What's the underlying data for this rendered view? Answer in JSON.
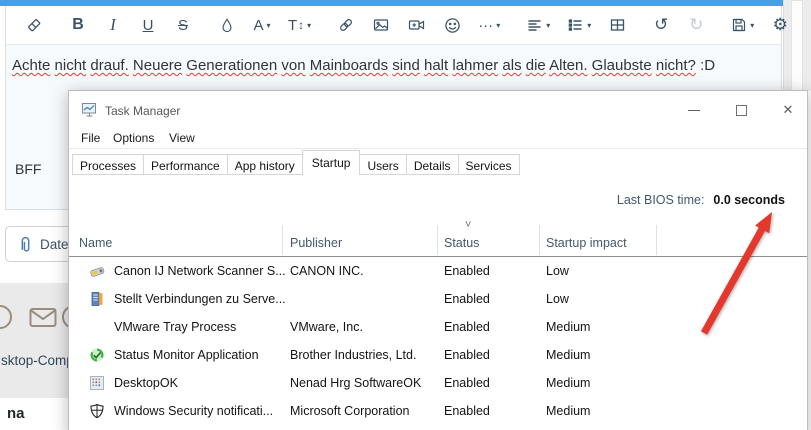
{
  "editor": {
    "message": "Achte nicht drauf. Neuere Generationen von Mainboards sind halt lahmer als die Alten. Glaubste nicht? :D",
    "signature": "BFF",
    "attach_button": "Datei",
    "toolbar": {
      "bold": "B",
      "italic": "I",
      "underline": "U",
      "strike": "S",
      "font_color": "A",
      "font_size": "T",
      "more_dots": "···",
      "undo": "↺",
      "redo": "↻",
      "gear": "⚙",
      "caret": "▾",
      "updown": "↕"
    }
  },
  "page": {
    "link_text": "sktop-Comp",
    "bottom_text": "na"
  },
  "task_manager": {
    "title": "Task Manager",
    "menus": [
      "File",
      "Options",
      "View"
    ],
    "tabs": [
      "Processes",
      "Performance",
      "App history",
      "Startup",
      "Users",
      "Details",
      "Services"
    ],
    "active_tab": "Startup",
    "last_bios_label": "Last BIOS time:",
    "last_bios_value": "0.0 seconds",
    "sort_indicator": "˅",
    "columns": [
      "Name",
      "Publisher",
      "Status",
      "Startup impact"
    ],
    "rows": [
      {
        "name": "Canon IJ Network Scanner S...",
        "publisher": "CANON INC.",
        "status": "Enabled",
        "impact": "Low",
        "icon": "canon-scanner-icon"
      },
      {
        "name": "Stellt Verbindungen zu Serve...",
        "publisher": "",
        "status": "Enabled",
        "impact": "Low",
        "icon": "server-connection-icon"
      },
      {
        "name": "VMware Tray Process",
        "publisher": "VMware, Inc.",
        "status": "Enabled",
        "impact": "Medium",
        "icon": "none"
      },
      {
        "name": "Status Monitor Application",
        "publisher": "Brother Industries, Ltd.",
        "status": "Enabled",
        "impact": "Medium",
        "icon": "status-monitor-icon"
      },
      {
        "name": "DesktopOK",
        "publisher": "Nenad Hrg SoftwareOK",
        "status": "Enabled",
        "impact": "Medium",
        "icon": "desktopok-icon"
      },
      {
        "name": "Windows Security notificati...",
        "publisher": "Microsoft Corporation",
        "status": "Enabled",
        "impact": "Medium",
        "icon": "windows-security-icon"
      }
    ],
    "window_controls": {
      "close": "✕"
    }
  },
  "colors": {
    "accent_blue": "#4A9FE3",
    "toolbar_icon": "#3A5368",
    "spellcheck_red": "#E2402F",
    "arrow_red": "#E5372B",
    "editor_bg": "#F6FAFD",
    "header_text": "#44596B"
  }
}
